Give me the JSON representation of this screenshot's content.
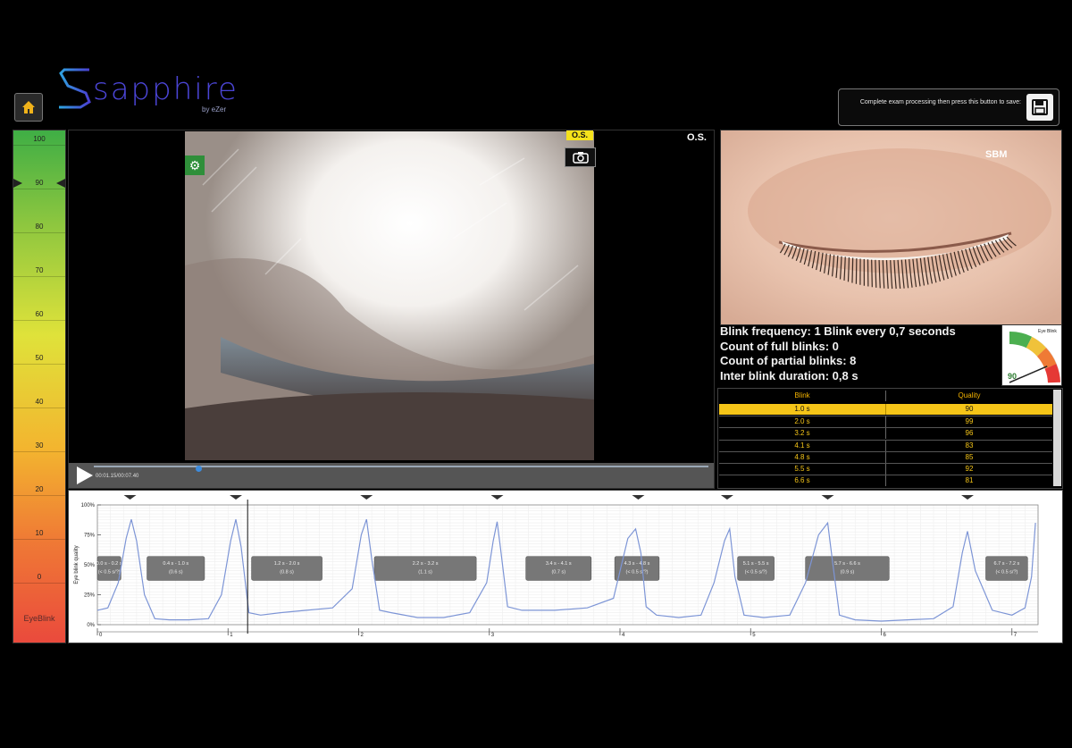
{
  "app": {
    "logo_text": "sapphire",
    "logo_sub": "by eZer"
  },
  "save": {
    "instruction": "Complete exam processing then press this button to save:"
  },
  "scale": {
    "ticks": [
      "100",
      "90",
      "80",
      "70",
      "60",
      "50",
      "40",
      "30",
      "20",
      "10",
      "0"
    ],
    "caption": "EyeBlink",
    "marker_value": 90
  },
  "video": {
    "eye_badge": "O.S.",
    "eye_label": "O.S.",
    "time": "00:01.15/00:07.40",
    "progress": 0.17
  },
  "stats": {
    "frequency": "Blink frequency:  1 Blink every  0,7 seconds",
    "full_blinks": "Count of full blinks:  0",
    "partial_blinks": "Count of partial blinks: 8",
    "inter_blink": "Inter blink duration: 0,8 s"
  },
  "illustration": {
    "watermark": "SBM"
  },
  "gauge": {
    "label": "Eye Blink",
    "value": "90",
    "fraction": 0.9
  },
  "table": {
    "headers": {
      "blink": "Blink",
      "quality": "Quality"
    },
    "rows": [
      {
        "blink": "1.0 s",
        "quality": "90",
        "selected": true
      },
      {
        "blink": "2.0 s",
        "quality": "99",
        "selected": false
      },
      {
        "blink": "3.2 s",
        "quality": "96",
        "selected": false
      },
      {
        "blink": "4.1 s",
        "quality": "83",
        "selected": false
      },
      {
        "blink": "4.8 s",
        "quality": "85",
        "selected": false
      },
      {
        "blink": "5.5 s",
        "quality": "92",
        "selected": false
      },
      {
        "blink": "6.6 s",
        "quality": "81",
        "selected": false
      }
    ]
  },
  "graph": {
    "ylabel": "Eye blink quality",
    "y_ticks": [
      "100%",
      "75%",
      "50%",
      "25%",
      "0%"
    ],
    "x_ticks": [
      "0",
      "1",
      "2",
      "3",
      "4",
      "5",
      "6",
      "7"
    ],
    "x_range": [
      0,
      7.2
    ],
    "cursor_time": 1.15,
    "blink_markers": [
      0.25,
      1.06,
      2.06,
      3.06,
      4.14,
      4.82,
      5.59,
      6.66
    ],
    "segments": [
      {
        "start": 0.0,
        "end": 0.18,
        "line1": "0.0 s - 0.2 s",
        "line2": "(< 0.5 s/?)"
      },
      {
        "start": 0.38,
        "end": 0.82,
        "line1": "0.4 s - 1.0 s",
        "line2": "(0.6 s)"
      },
      {
        "start": 1.18,
        "end": 1.72,
        "line1": "1.2 s - 2.0 s",
        "line2": "(0.8 s)"
      },
      {
        "start": 2.12,
        "end": 2.9,
        "line1": "2.2 s - 3.2 s",
        "line2": "(1.1 s)"
      },
      {
        "start": 3.28,
        "end": 3.78,
        "line1": "3.4 s - 4.1 s",
        "line2": "(0.7 s)"
      },
      {
        "start": 3.96,
        "end": 4.3,
        "line1": "4.3 s - 4.8 s",
        "line2": "(< 0.5 s/?)"
      },
      {
        "start": 4.9,
        "end": 5.18,
        "line1": "5.1 s - 5.5 s",
        "line2": "(< 0.5 s/?)"
      },
      {
        "start": 5.42,
        "end": 6.06,
        "line1": "5.7 s - 6.6 s",
        "line2": "(0.9 s)"
      },
      {
        "start": 6.8,
        "end": 7.12,
        "line1": "6.7 s - 7.2 s",
        "line2": "(< 0.5 s/?)"
      }
    ],
    "series": {
      "x": [
        0.0,
        0.08,
        0.16,
        0.22,
        0.26,
        0.3,
        0.36,
        0.44,
        0.55,
        0.7,
        0.85,
        0.95,
        1.02,
        1.06,
        1.1,
        1.16,
        1.25,
        1.4,
        1.6,
        1.8,
        1.95,
        2.02,
        2.06,
        2.1,
        2.16,
        2.25,
        2.45,
        2.65,
        2.85,
        2.98,
        3.03,
        3.06,
        3.09,
        3.14,
        3.25,
        3.5,
        3.75,
        3.95,
        4.06,
        4.12,
        4.16,
        4.2,
        4.28,
        4.45,
        4.62,
        4.72,
        4.8,
        4.84,
        4.88,
        4.95,
        5.1,
        5.3,
        5.42,
        5.52,
        5.59,
        5.63,
        5.68,
        5.8,
        6.0,
        6.2,
        6.4,
        6.55,
        6.62,
        6.66,
        6.72,
        6.85,
        7.0,
        7.1,
        7.15,
        7.18
      ],
      "y": [
        12,
        14,
        35,
        72,
        88,
        70,
        25,
        5,
        4,
        4,
        5,
        25,
        70,
        88,
        65,
        10,
        8,
        10,
        12,
        14,
        30,
        75,
        88,
        55,
        12,
        10,
        6,
        6,
        10,
        35,
        70,
        86,
        60,
        15,
        12,
        12,
        14,
        22,
        72,
        80,
        60,
        15,
        8,
        6,
        8,
        35,
        70,
        80,
        40,
        8,
        6,
        8,
        35,
        75,
        85,
        50,
        8,
        4,
        3,
        4,
        5,
        15,
        60,
        78,
        45,
        12,
        8,
        14,
        40,
        85
      ]
    }
  }
}
